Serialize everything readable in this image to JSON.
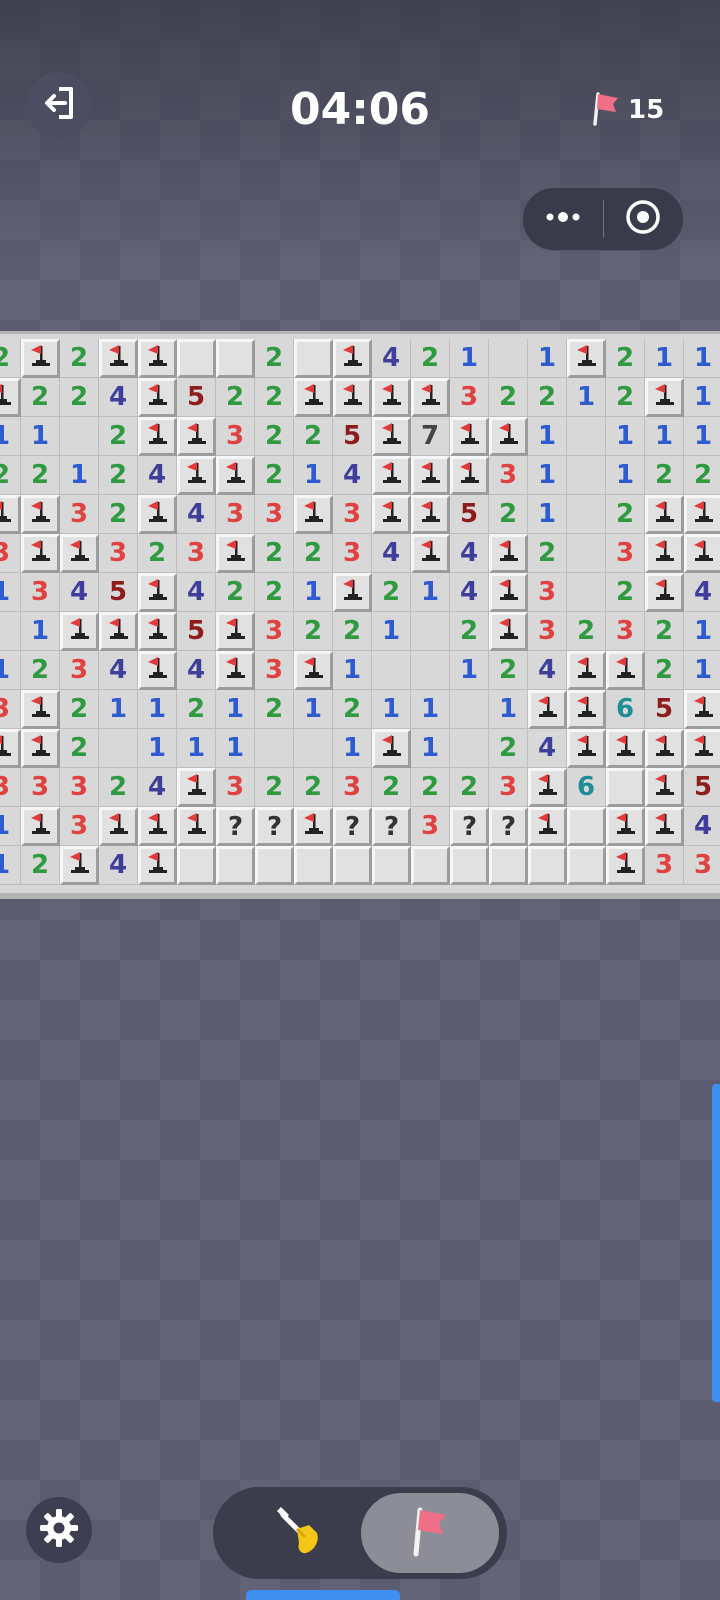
{
  "header": {
    "timer": "04:06",
    "flags_remaining": "15",
    "exit_icon": "exit-icon",
    "flag_icon": "flag-icon"
  },
  "capsule": {
    "more_icon": "more-dots-icon",
    "close_icon": "target-close-icon"
  },
  "board": {
    "legend": "F = flagged cell, H = unrevealed cell, ? = question mark, 0 = revealed empty, digit = adjacent mine count",
    "rows": [
      [
        "2",
        "F",
        "2",
        "F",
        "F",
        "H",
        "H",
        "2",
        "H",
        "F",
        "4",
        "2",
        "1",
        "0",
        "1",
        "F",
        "2",
        "1",
        "1"
      ],
      [
        "F",
        "2",
        "2",
        "4",
        "F",
        "5",
        "2",
        "2",
        "F",
        "F",
        "F",
        "F",
        "3",
        "2",
        "2",
        "1",
        "2",
        "F",
        "1"
      ],
      [
        "1",
        "1",
        "0",
        "2",
        "F",
        "F",
        "3",
        "2",
        "2",
        "5",
        "F",
        "7",
        "F",
        "F",
        "1",
        "0",
        "1",
        "1",
        "1"
      ],
      [
        "2",
        "2",
        "1",
        "2",
        "4",
        "F",
        "F",
        "2",
        "1",
        "4",
        "F",
        "F",
        "F",
        "3",
        "1",
        "0",
        "1",
        "2",
        "2"
      ],
      [
        "F",
        "F",
        "3",
        "2",
        "F",
        "4",
        "3",
        "3",
        "F",
        "3",
        "F",
        "F",
        "5",
        "2",
        "1",
        "0",
        "2",
        "F",
        "F"
      ],
      [
        "3",
        "F",
        "F",
        "3",
        "2",
        "3",
        "F",
        "2",
        "2",
        "3",
        "4",
        "F",
        "4",
        "F",
        "2",
        "0",
        "3",
        "F",
        "F"
      ],
      [
        "1",
        "3",
        "4",
        "5",
        "F",
        "4",
        "2",
        "2",
        "1",
        "F",
        "2",
        "1",
        "4",
        "F",
        "3",
        "0",
        "2",
        "F",
        "4"
      ],
      [
        "0",
        "1",
        "F",
        "F",
        "F",
        "5",
        "F",
        "3",
        "2",
        "2",
        "1",
        "0",
        "2",
        "F",
        "3",
        "2",
        "3",
        "2",
        "1"
      ],
      [
        "1",
        "2",
        "3",
        "4",
        "F",
        "4",
        "F",
        "3",
        "F",
        "1",
        "0",
        "0",
        "1",
        "2",
        "4",
        "F",
        "F",
        "2",
        "1"
      ],
      [
        "3",
        "F",
        "2",
        "1",
        "1",
        "2",
        "1",
        "2",
        "1",
        "2",
        "1",
        "1",
        "0",
        "1",
        "F",
        "F",
        "6",
        "5",
        "F"
      ],
      [
        "F",
        "F",
        "2",
        "0",
        "1",
        "1",
        "1",
        "0",
        "0",
        "1",
        "F",
        "1",
        "0",
        "2",
        "4",
        "F",
        "F",
        "F",
        "F"
      ],
      [
        "3",
        "3",
        "3",
        "2",
        "4",
        "F",
        "3",
        "2",
        "2",
        "3",
        "2",
        "2",
        "2",
        "3",
        "F",
        "6",
        "H",
        "F",
        "5"
      ],
      [
        "1",
        "F",
        "3",
        "F",
        "F",
        "F",
        "?",
        "?",
        "F",
        "?",
        "?",
        "3",
        "?",
        "?",
        "F",
        "H",
        "F",
        "F",
        "4"
      ],
      [
        "1",
        "2",
        "F",
        "4",
        "F",
        "H",
        "H",
        "H",
        "H",
        "H",
        "H",
        "H",
        "H",
        "H",
        "H",
        "H",
        "F",
        "3",
        "3"
      ]
    ]
  },
  "footer": {
    "settings_icon": "gear-icon",
    "dig_mode_icon": "shovel-icon",
    "flag_mode_icon": "flag-icon",
    "active_mode": "flag"
  },
  "colors": {
    "n1": "#2f5bd0",
    "n2": "#2f9a3f",
    "n3": "#e04141",
    "n4": "#3e3f9a",
    "n5": "#8e1c1c",
    "n6": "#1e8f95",
    "n7": "#444444",
    "flag": "#e23a3a",
    "accent": "#3f8ff0"
  }
}
